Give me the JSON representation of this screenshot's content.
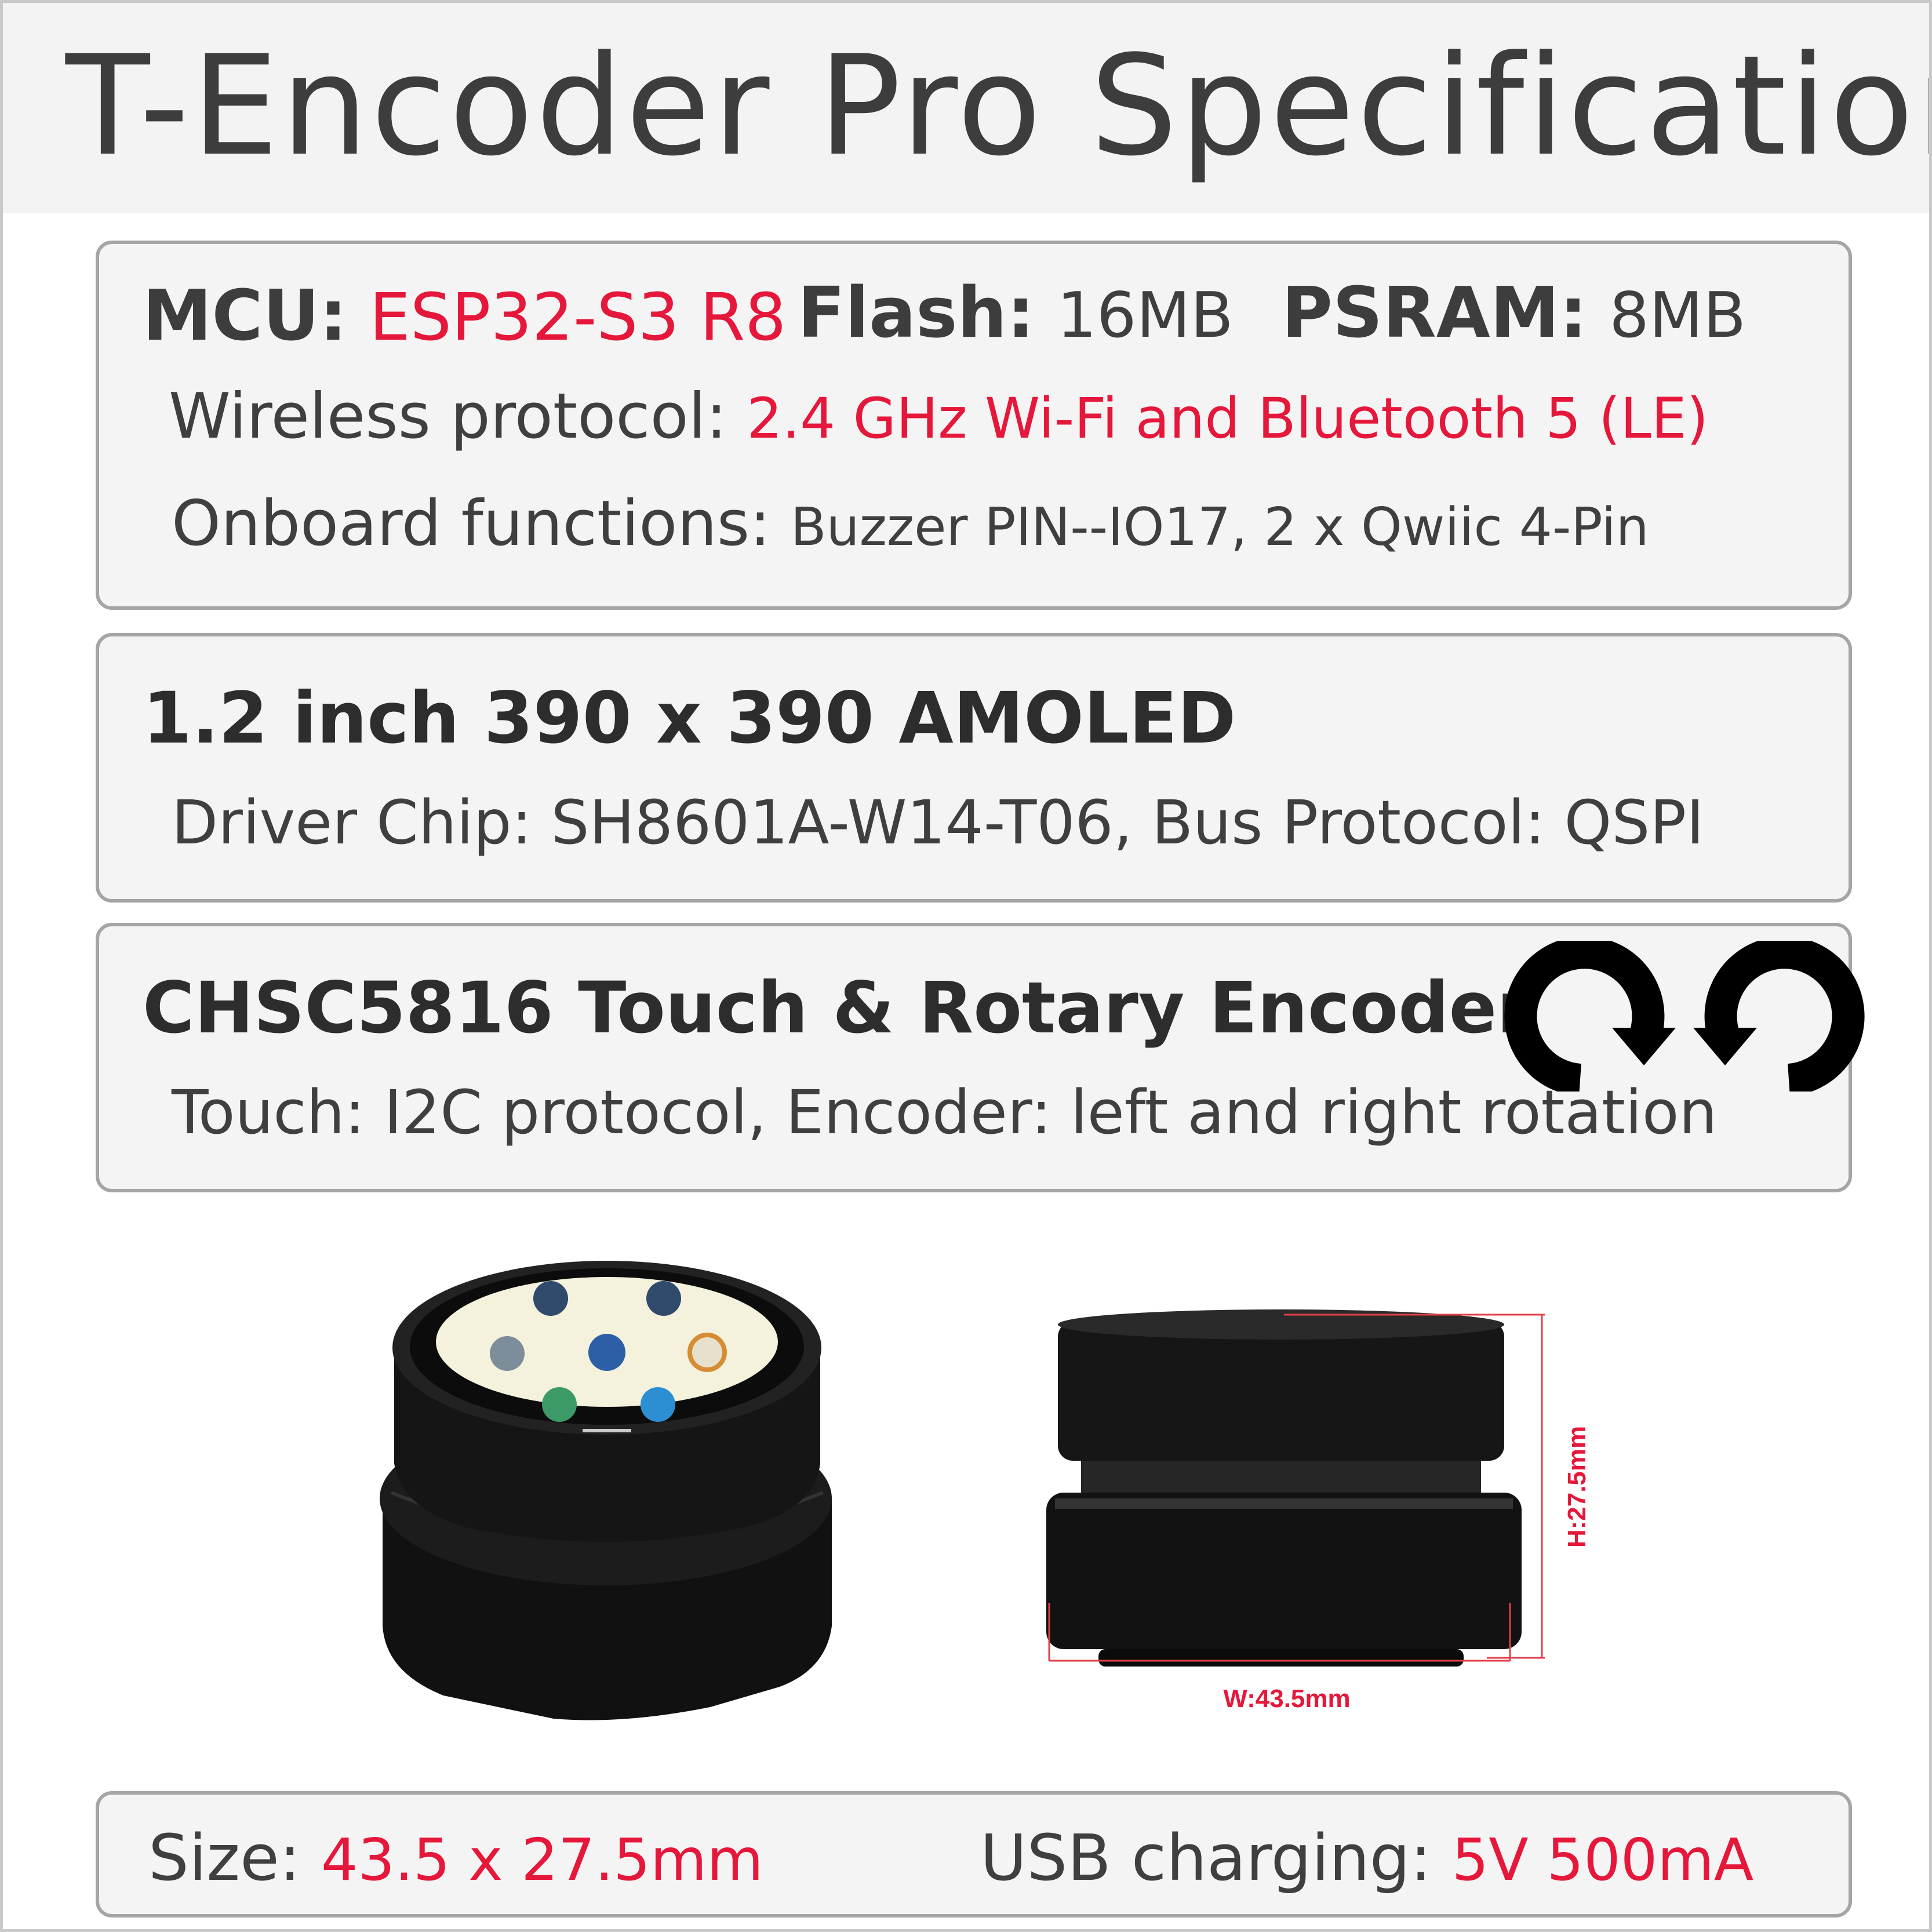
{
  "title": "T-Encoder Pro Specifications",
  "box1": {
    "mcu_label": "MCU:",
    "mcu_value": "ESP32-S3 R8",
    "flash_label": "Flash:",
    "flash_value": "16MB",
    "psram_label": "PSRAM:",
    "psram_value": "8MB",
    "wireless_label": "Wireless protocol:",
    "wireless_value": "2.4 GHz Wi-Fi and Bluetooth 5 (LE)",
    "onboard_label": "Onboard functions:",
    "onboard_value": "Buzzer PIN--IO17, 2 x Qwiic 4-Pin"
  },
  "box2": {
    "heading": "1.2 inch 390 x 390 AMOLED",
    "detail": "Driver Chip: SH8601A-W14-T06, Bus Protocol: QSPI"
  },
  "box3": {
    "heading": "CHSC5816 Touch & Rotary Encoder",
    "detail": "Touch: I2C protocol, Encoder: left and right rotation",
    "icons": [
      "rotate-clockwise-icon",
      "rotate-counterclockwise-icon"
    ]
  },
  "dimensions": {
    "height_label": "H:27.5mm",
    "width_label": "W:43.5mm"
  },
  "box4": {
    "size_label": "Size:",
    "size_value": "43.5 x 27.5mm",
    "usb_label": "USB charging:",
    "usb_value": "5V 500mA"
  },
  "colors": {
    "accent_red": "#e5173a",
    "box_border": "#a5a5a5",
    "box_fill": "#f4f4f4",
    "header_fill": "#f3f3f3"
  }
}
